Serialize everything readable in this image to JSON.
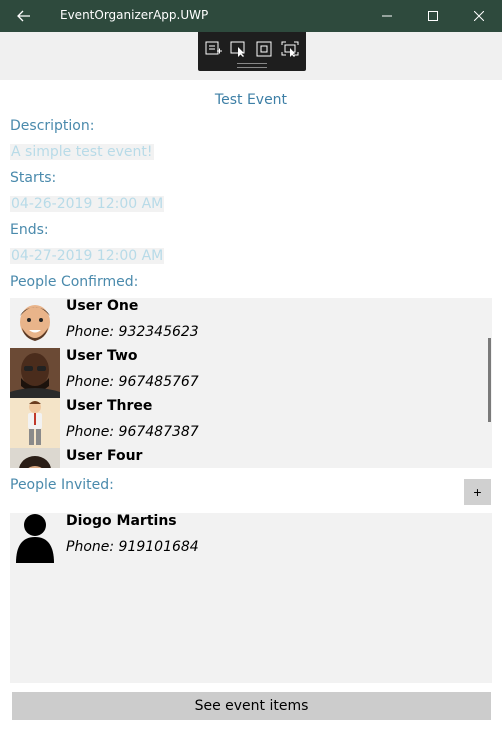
{
  "window": {
    "title": "EventOrganizerApp.UWP"
  },
  "event": {
    "title": "Test Event",
    "description_label": "Description:",
    "description": "A simple test event!",
    "starts_label": "Starts:",
    "starts": "04-26-2019 12:00 AM",
    "ends_label": "Ends:",
    "ends": "04-27-2019 12:00 AM"
  },
  "confirmed": {
    "label": "People Confirmed:",
    "people": [
      {
        "name": "User One",
        "phone": "Phone: 932345623"
      },
      {
        "name": "User Two",
        "phone": "Phone: 967485767"
      },
      {
        "name": "User Three",
        "phone": "Phone: 967487387"
      },
      {
        "name": "User Four",
        "phone": ""
      }
    ]
  },
  "invited": {
    "label": "People Invited:",
    "add_label": "+",
    "people": [
      {
        "name": "Diogo Martins",
        "phone": "Phone: 919101684"
      }
    ]
  },
  "actions": {
    "see_items_label": "See event items"
  },
  "colors": {
    "titlebar": "#2e4a3d",
    "label": "#4a8aac",
    "value": "#b8dbe8",
    "title": "#3d7fa6"
  }
}
